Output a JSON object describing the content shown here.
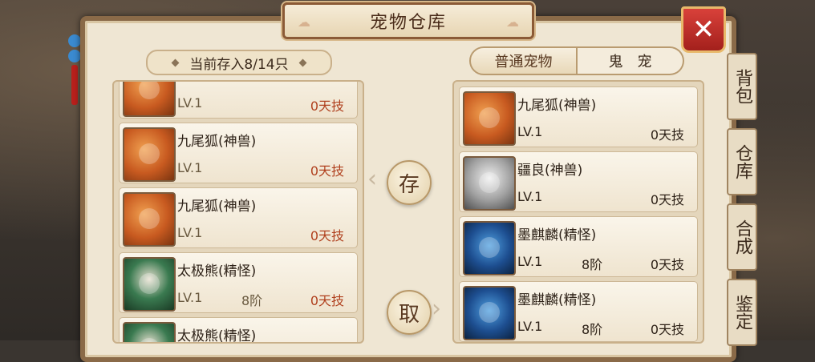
{
  "title": "宠物仓库",
  "close_label": "✕",
  "capacity": "当前存入8/14只",
  "tabs": [
    {
      "label": "普通宠物",
      "active": true
    },
    {
      "label": "鬼宠",
      "active": false
    }
  ],
  "buttons": {
    "store": "存",
    "retrieve": "取"
  },
  "side_tabs": [
    {
      "label": "背包"
    },
    {
      "label": "仓库"
    },
    {
      "label": "合成"
    },
    {
      "label": "鉴定"
    }
  ],
  "warehouse": [
    {
      "name": "",
      "avatar": "fox",
      "level": "LV.1",
      "stage": "",
      "skills": "0天技"
    },
    {
      "name": "九尾狐(神兽)",
      "avatar": "fox",
      "level": "LV.1",
      "stage": "",
      "skills": "0天技"
    },
    {
      "name": "九尾狐(神兽)",
      "avatar": "fox",
      "level": "LV.1",
      "stage": "",
      "skills": "0天技"
    },
    {
      "name": "太极熊(精怪)",
      "avatar": "bear",
      "level": "LV.1",
      "stage": "8阶",
      "skills": "0天技"
    },
    {
      "name": "太极熊(精怪)",
      "avatar": "bear",
      "level": "",
      "stage": "",
      "skills": ""
    }
  ],
  "carried": [
    {
      "name": "九尾狐(神兽)",
      "avatar": "fox",
      "level": "LV.1",
      "stage": "",
      "skills": "0天技"
    },
    {
      "name": "疆良(神兽)",
      "avatar": "tiger",
      "level": "LV.1",
      "stage": "",
      "skills": "0天技"
    },
    {
      "name": "墨麒麟(精怪)",
      "avatar": "qilin",
      "level": "LV.1",
      "stage": "8阶",
      "skills": "0天技"
    },
    {
      "name": "墨麒麟(精怪)",
      "avatar": "qilin",
      "level": "LV.1",
      "stage": "8阶",
      "skills": "0天技"
    }
  ],
  "colors": {
    "panel": "#efe6d3",
    "close": "#c8302a",
    "skill_text": "#b0401e"
  }
}
